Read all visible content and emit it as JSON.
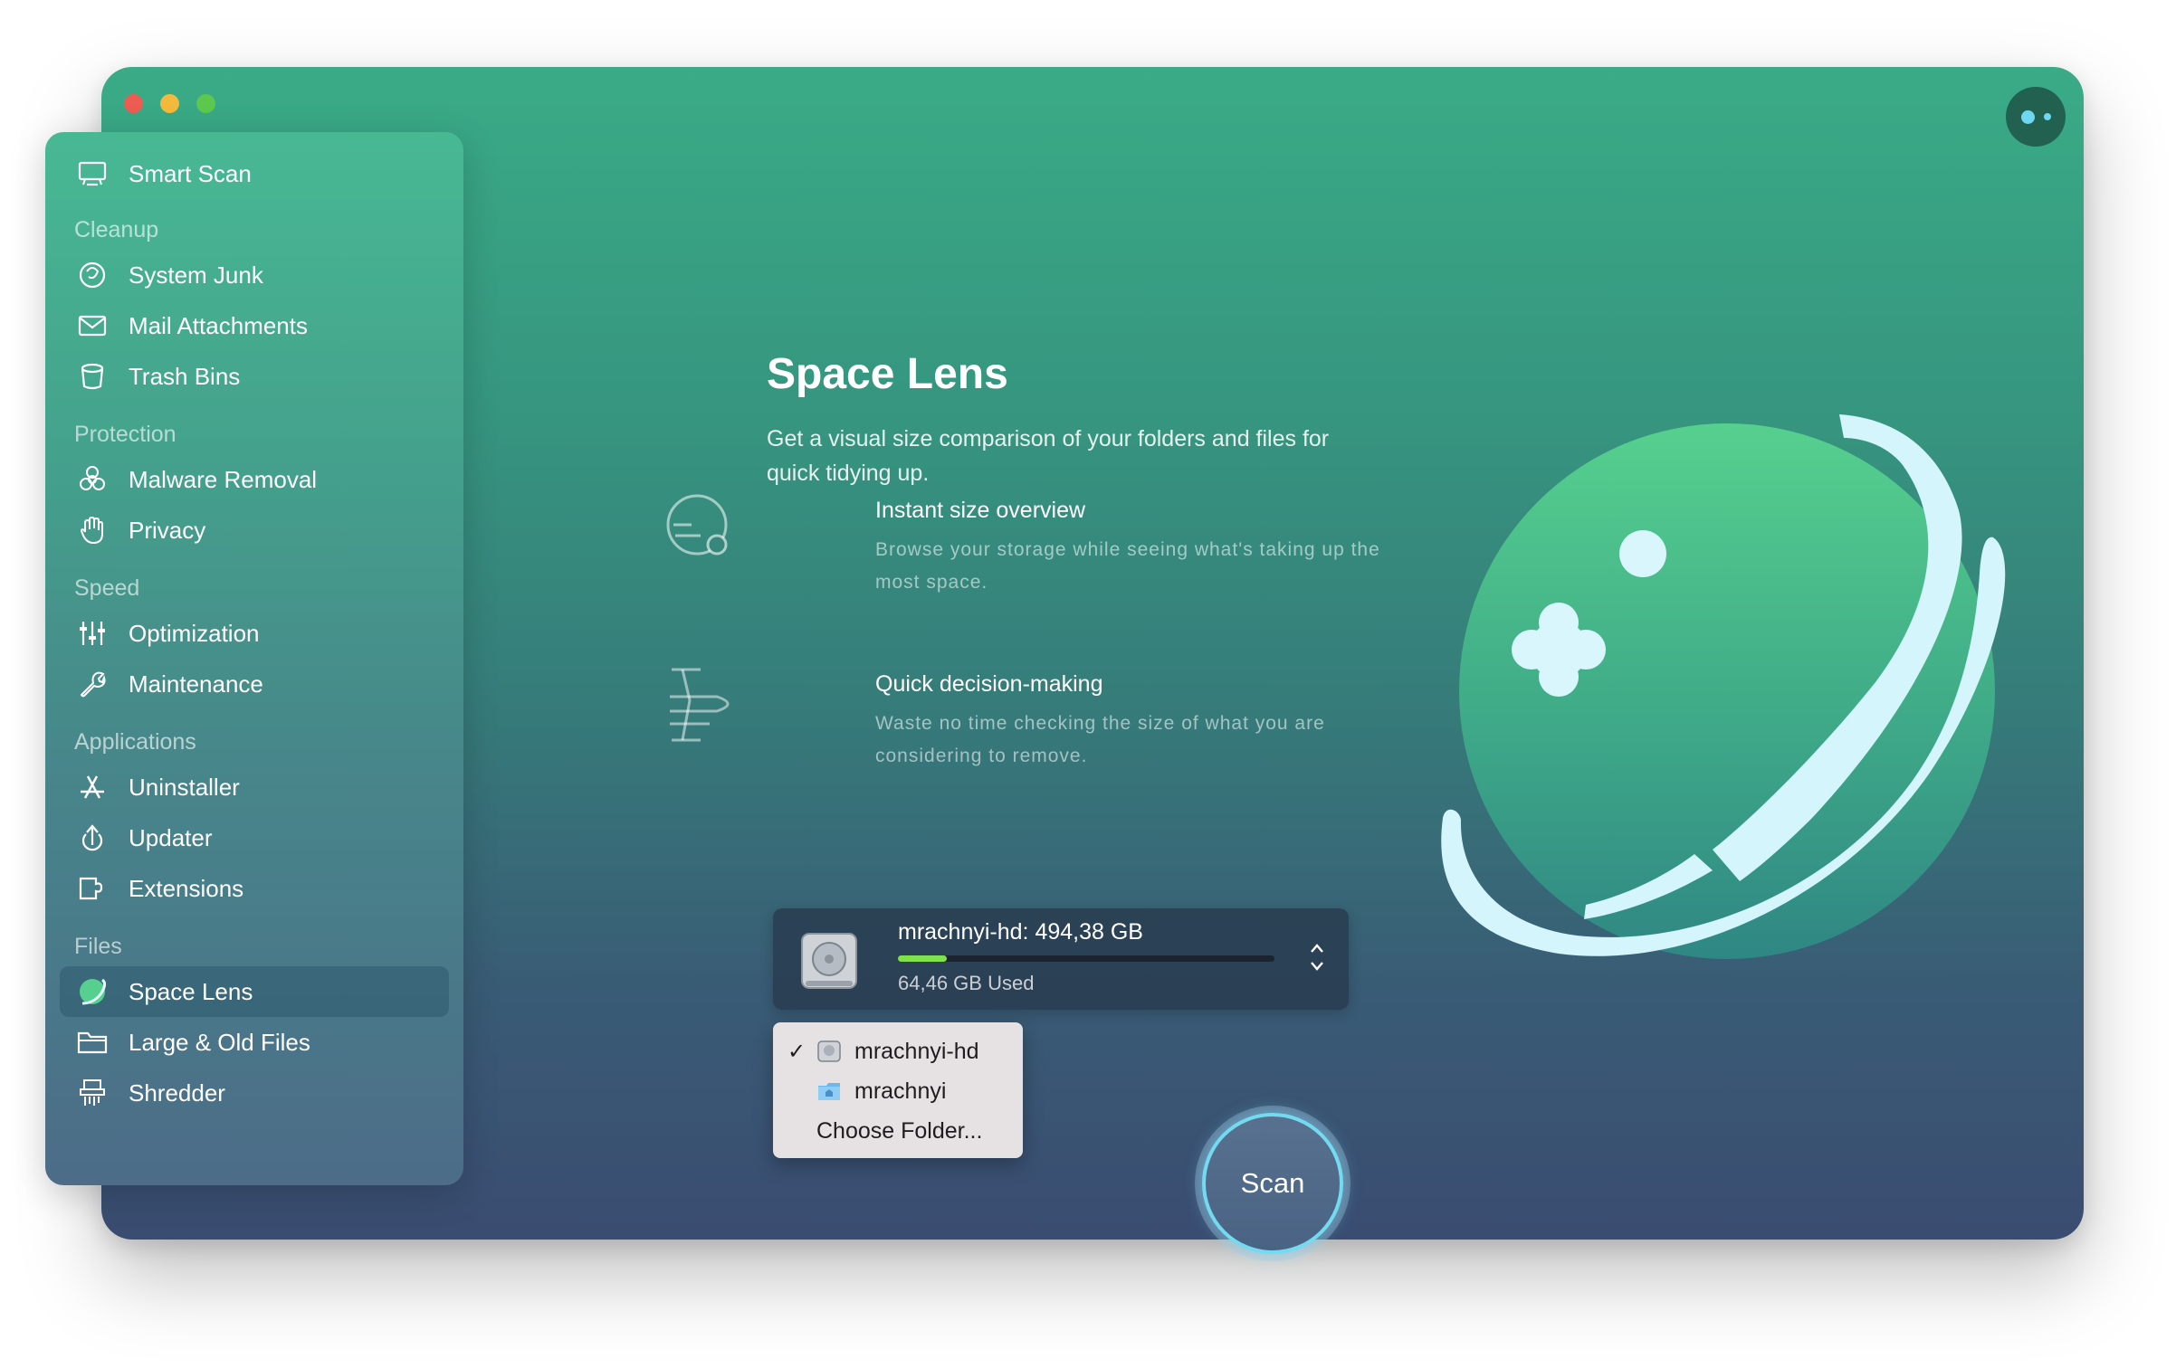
{
  "sidebar": {
    "smart_scan": "Smart Scan",
    "sections": {
      "cleanup": "Cleanup",
      "protection": "Protection",
      "speed": "Speed",
      "applications": "Applications",
      "files": "Files"
    },
    "items": {
      "system_junk": "System Junk",
      "mail_attachments": "Mail Attachments",
      "trash_bins": "Trash Bins",
      "malware_removal": "Malware Removal",
      "privacy": "Privacy",
      "optimization": "Optimization",
      "maintenance": "Maintenance",
      "uninstaller": "Uninstaller",
      "updater": "Updater",
      "extensions": "Extensions",
      "space_lens": "Space Lens",
      "large_old_files": "Large & Old Files",
      "shredder": "Shredder"
    },
    "active": "space_lens"
  },
  "main": {
    "title": "Space Lens",
    "subtitle": "Get a visual size comparison of your folders and files for quick tidying up.",
    "features": [
      {
        "icon": "size-overview-icon",
        "title": "Instant size overview",
        "description": "Browse your storage while seeing what's taking up the most space."
      },
      {
        "icon": "decision-icon",
        "title": "Quick decision-making",
        "description": "Waste no time checking the size of what you are considering to remove."
      }
    ]
  },
  "disk": {
    "name_label": "mrachnyi-hd: 494,38 GB",
    "used_label": "64,46 GB Used",
    "used_fraction": 0.13
  },
  "dropdown": {
    "items": [
      {
        "label": "mrachnyi-hd",
        "checked": true,
        "icon": "hard-drive-icon"
      },
      {
        "label": "mrachnyi",
        "checked": false,
        "icon": "home-folder-icon"
      },
      {
        "label": "Choose Folder...",
        "checked": false,
        "icon": ""
      }
    ]
  },
  "scan": {
    "label": "Scan"
  },
  "colors": {
    "accent_ring": "#74daf0",
    "usage_bar": "#7fe24a",
    "traffic_close": "#ee5b52",
    "traffic_min": "#f4b83a",
    "traffic_max": "#5cc84e"
  }
}
